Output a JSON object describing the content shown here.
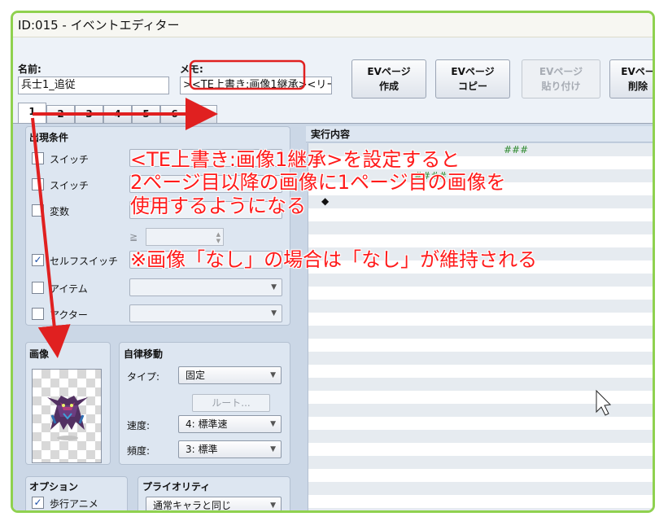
{
  "window": {
    "title": "ID:015 - イベントエディター"
  },
  "header": {
    "name_label": "名前:",
    "name_value": "兵士1_追従",
    "memo_label": "メモ:",
    "memo_value": "><TE上書き:画像1継承><リー",
    "buttons": [
      {
        "label": "EVページ\n作成",
        "enabled": true
      },
      {
        "label": "EVページ\nコピー",
        "enabled": true
      },
      {
        "label": "EVページ\n貼り付け",
        "enabled": false
      },
      {
        "label": "EVペー\n削除",
        "enabled": true
      }
    ]
  },
  "tabs": [
    "1",
    "2",
    "3",
    "4",
    "5",
    "6",
    "7"
  ],
  "conditions": {
    "title": "出現条件",
    "switch1_label": "スイッチ",
    "switch2_label": "スイッチ",
    "variable_label": "変数",
    "ge_symbol": "≧",
    "self_switch_label": "セルフスイッチ",
    "self_switch_checked": true,
    "item_label": "アイテム",
    "actor_label": "アクター"
  },
  "image": {
    "title": "画像"
  },
  "autonomous": {
    "title": "自律移動",
    "type_label": "タイプ:",
    "type_value": "固定",
    "route_button": "ルート...",
    "speed_label": "速度:",
    "speed_value": "4: 標準速",
    "freq_label": "頻度:",
    "freq_value": "3: 標準"
  },
  "options": {
    "title": "オプション",
    "walk_anim_label": "歩行アニメ",
    "walk_anim_checked": true
  },
  "priority": {
    "title": "プライオリティ",
    "value": "通常キャラと同じ"
  },
  "execution": {
    "title": "実行内容",
    "row1_fragment": "###",
    "row2_fragment": "####",
    "row3_marker": "◆"
  },
  "annotation": {
    "line1": "<TE上書き:画像1継承>を設定すると",
    "line2": "2ページ目以降の画像に1ページ目の画像を",
    "line3": "使用するようになる",
    "line4": "※画像「なし」の場合は「なし」が維持される",
    "color": "#ff1a1a"
  },
  "colors": {
    "frame_border": "#8fd14f",
    "panel_bg": "#cbd7e6",
    "arrow": "#e02020"
  }
}
